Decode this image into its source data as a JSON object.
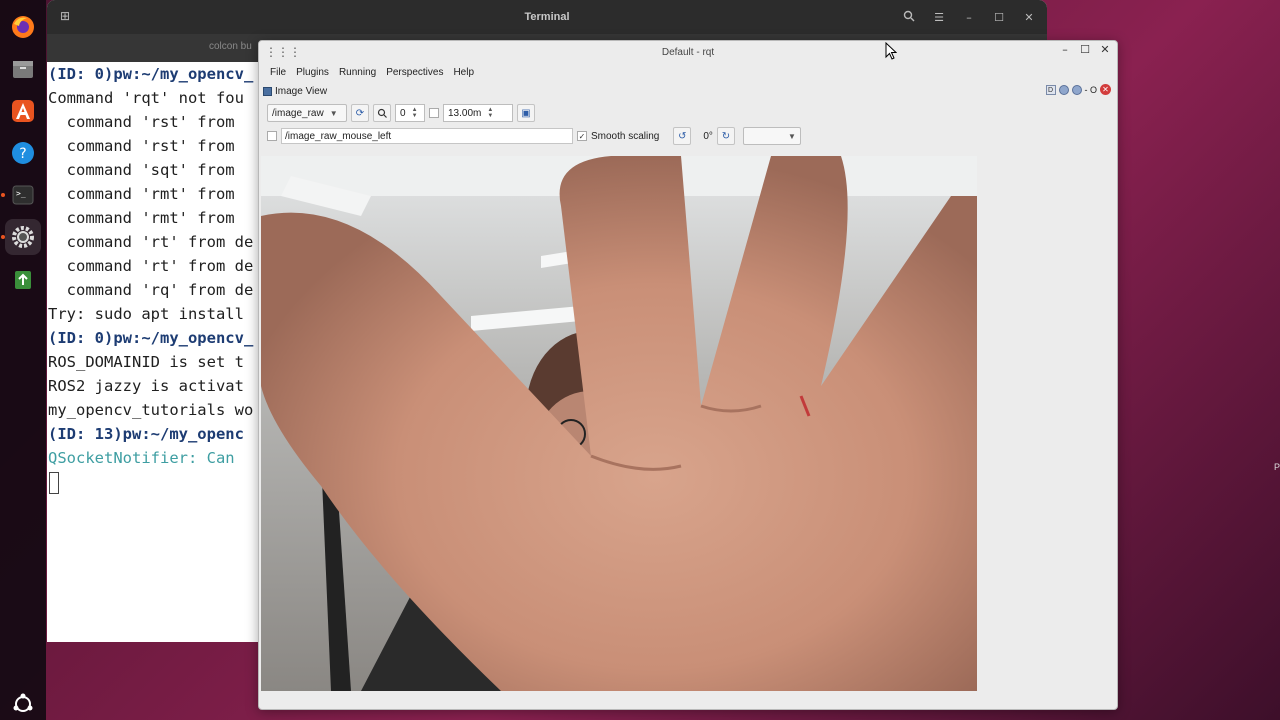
{
  "terminal": {
    "title": "Terminal",
    "tab_label": "colcon bu",
    "lines": [
      {
        "prompt": "(ID: 0)pw:~/my_opencv_",
        "text": ""
      },
      {
        "prompt": "",
        "text": "Command 'rqt' not fou"
      },
      {
        "prompt": "",
        "text": "  command 'rst' from "
      },
      {
        "prompt": "",
        "text": "  command 'rst' from "
      },
      {
        "prompt": "",
        "text": "  command 'sqt' from "
      },
      {
        "prompt": "",
        "text": "  command 'rmt' from "
      },
      {
        "prompt": "",
        "text": "  command 'rmt' from "
      },
      {
        "prompt": "",
        "text": "  command 'rt' from de"
      },
      {
        "prompt": "",
        "text": "  command 'rt' from de"
      },
      {
        "prompt": "",
        "text": "  command 'rq' from de"
      },
      {
        "prompt": "",
        "text": "Try: sudo apt install"
      },
      {
        "prompt": "(ID: 0)pw:~/my_opencv_",
        "text": ""
      },
      {
        "prompt": "",
        "text": "ROS_DOMAINID is set t"
      },
      {
        "prompt": "",
        "text": "ROS2 jazzy is activat"
      },
      {
        "prompt": "",
        "text": "my_opencv_tutorials wo"
      },
      {
        "prompt": "(ID: 13)pw:~/my_openc",
        "text": ""
      },
      {
        "prompt": "",
        "text": "QSocketNotifier: Can ",
        "cyan": true
      }
    ]
  },
  "rqt": {
    "title": "Default - rqt",
    "menu": [
      "File",
      "Plugins",
      "Running",
      "Perspectives",
      "Help"
    ],
    "plugin_title": "Image View",
    "plugin_badge": "D",
    "plugin_ctrl_text": "- O",
    "topic": "/image_raw",
    "spin_value": "0",
    "max_range": "13.00m",
    "mouse_topic": "/image_raw_mouse_left",
    "smooth_scaling_label": "Smooth scaling",
    "smooth_scaling_checked": true,
    "rotation": "0°"
  },
  "colors": {
    "accent": "#e95420",
    "prompt": "#1d3c73",
    "cyan": "#3e9ea2"
  },
  "right_edge_text": "P"
}
